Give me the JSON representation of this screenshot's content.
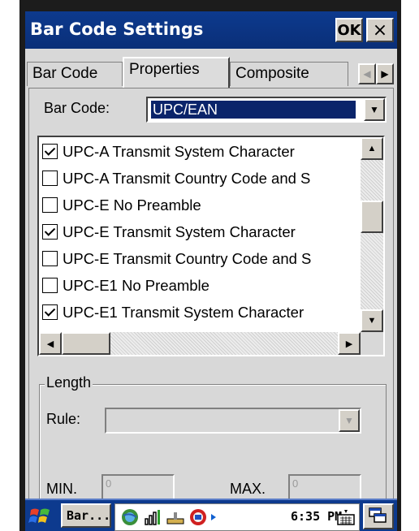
{
  "window": {
    "title": "Bar Code Settings",
    "ok_label": "OK",
    "close_label": "×"
  },
  "tabs": [
    {
      "label": "Bar Code",
      "active": false
    },
    {
      "label": "Properties",
      "active": true
    },
    {
      "label": "Composite",
      "active": false
    }
  ],
  "tab_scroll": {
    "left": "◀",
    "right": "▶"
  },
  "barcode": {
    "label": "Bar Code:",
    "selected": "UPC/EAN"
  },
  "options": [
    {
      "label": "UPC-A Transmit System Character",
      "checked": true
    },
    {
      "label": "UPC-A Transmit Country Code and S",
      "checked": false
    },
    {
      "label": "UPC-E No Preamble",
      "checked": false
    },
    {
      "label": "UPC-E Transmit System Character",
      "checked": true
    },
    {
      "label": "UPC-E Transmit Country Code and S",
      "checked": false
    },
    {
      "label": "UPC-E1 No Preamble",
      "checked": false
    },
    {
      "label": "UPC-E1 Transmit System Character",
      "checked": true
    }
  ],
  "length": {
    "title": "Length",
    "rule_label": "Rule:",
    "min_label": "MIN.",
    "min_value": "0",
    "max_label": "MAX.",
    "max_value": "0"
  },
  "taskbar": {
    "task_label": "Bar...",
    "clock": "6:35 PM"
  },
  "colors": {
    "title_bar": "#0d3a8e",
    "selection": "#0a246a",
    "face": "#d8d8d8"
  },
  "icons": [
    "start-flag-icon",
    "internet-explorer-icon",
    "signal-icon",
    "connection-icon",
    "network-icon",
    "arrow-right-icon",
    "keyboard-icon",
    "windows-icon"
  ]
}
